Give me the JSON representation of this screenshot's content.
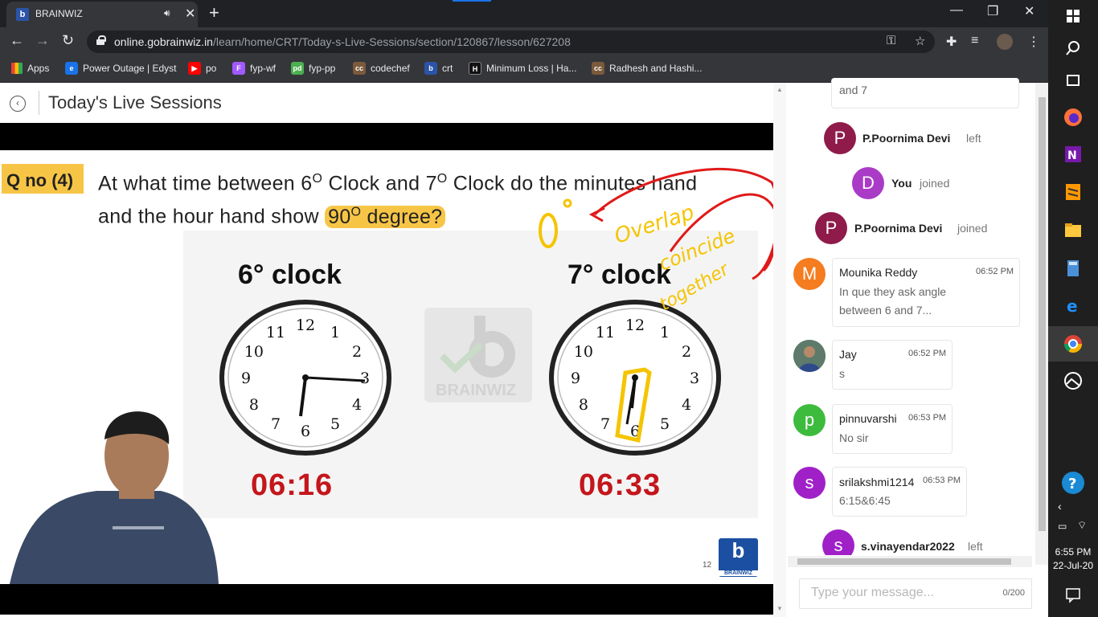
{
  "browser": {
    "tab_title": "BRAINWIZ",
    "url_host": "online.gobrainwiz.in",
    "url_path": "/learn/home/CRT/Today-s-Live-Sessions/section/120867/lesson/627208",
    "bookmarks": [
      {
        "label": "Apps",
        "icon": "apps-grid-icon",
        "color": "#e8eaed"
      },
      {
        "label": "Power Outage | Edyst",
        "icon": "edyst-icon",
        "color": "#1a73e8"
      },
      {
        "label": "po",
        "icon": "youtube-icon",
        "color": "#ff0000"
      },
      {
        "label": "fyp-wf",
        "icon": "figma-icon",
        "color": "#a259ff"
      },
      {
        "label": "fyp-pp",
        "icon": "fyp-icon",
        "color": "#4caf50"
      },
      {
        "label": "codechef",
        "icon": "codechef-icon",
        "color": "#7b5a3b"
      },
      {
        "label": "crt",
        "icon": "brainwiz-icon",
        "color": "#2b54a8"
      },
      {
        "label": "Minimum Loss | Ha...",
        "icon": "hackerrank-icon",
        "color": "#111111"
      },
      {
        "label": "Radhesh and Hashi...",
        "icon": "codechef-icon",
        "color": "#7b5a3b"
      }
    ]
  },
  "page": {
    "title": "Today's Live Sessions"
  },
  "slide": {
    "qno": "Q no (4)",
    "question_line1": "At what time between 6",
    "question_sup1": "O",
    "question_mid1": " Clock and 7",
    "question_sup2": "O",
    "question_end1": " Clock do the minutes hand",
    "question_line2": "and the hour hand show ",
    "question_hl": "90",
    "question_hl_sup": "O",
    "question_hl_end": " degree?",
    "left_clock_label": "6° clock",
    "right_clock_label": "7° clock",
    "left_time": "06:16",
    "right_time": "06:33",
    "watermark": "BRAINWIZ",
    "slide_number": "12",
    "logo_text": "BRAINWIZ",
    "clock_numbers": [
      "12",
      "1",
      "2",
      "3",
      "4",
      "5",
      "6",
      "7",
      "8",
      "9",
      "10",
      "11"
    ],
    "annotation": "O° Overlap coincide together"
  },
  "chat": {
    "events": [
      {
        "type": "fragment",
        "text": "and 7"
      },
      {
        "type": "system",
        "initial": "P",
        "name": "P.Poornima Devi",
        "action": "left",
        "color": "#8e1b4a"
      },
      {
        "type": "system",
        "initial": "D",
        "name": "You",
        "action": "joined",
        "color": "#a93bc7"
      },
      {
        "type": "system",
        "initial": "P",
        "name": "P.Poornima Devi",
        "action": "joined",
        "color": "#8e1b4a"
      },
      {
        "type": "message",
        "initial": "M",
        "name": "Mounika Reddy",
        "time": "06:52 PM",
        "text": "In que they ask angle between 6 and 7...",
        "color": "#f57c1f"
      },
      {
        "type": "message",
        "initial": "",
        "name": "Jay",
        "time": "06:52 PM",
        "text": "s",
        "color": "#4a6a5a"
      },
      {
        "type": "message",
        "initial": "p",
        "name": "pinnuvarshi",
        "time": "06:53 PM",
        "text": "No sir",
        "color": "#3dbb3d"
      },
      {
        "type": "message",
        "initial": "s",
        "name": "srilakshmi1214",
        "time": "06:53 PM",
        "text": "6:15&6:45",
        "color": "#a020c8"
      },
      {
        "type": "system",
        "initial": "s",
        "name": "s.vinayendar2022",
        "action": "left",
        "color": "#a020c8"
      }
    ],
    "placeholder": "Type your message...",
    "char_count": "0/200"
  },
  "taskbar": {
    "time": "6:55 PM",
    "date": "22-Jul-20"
  }
}
